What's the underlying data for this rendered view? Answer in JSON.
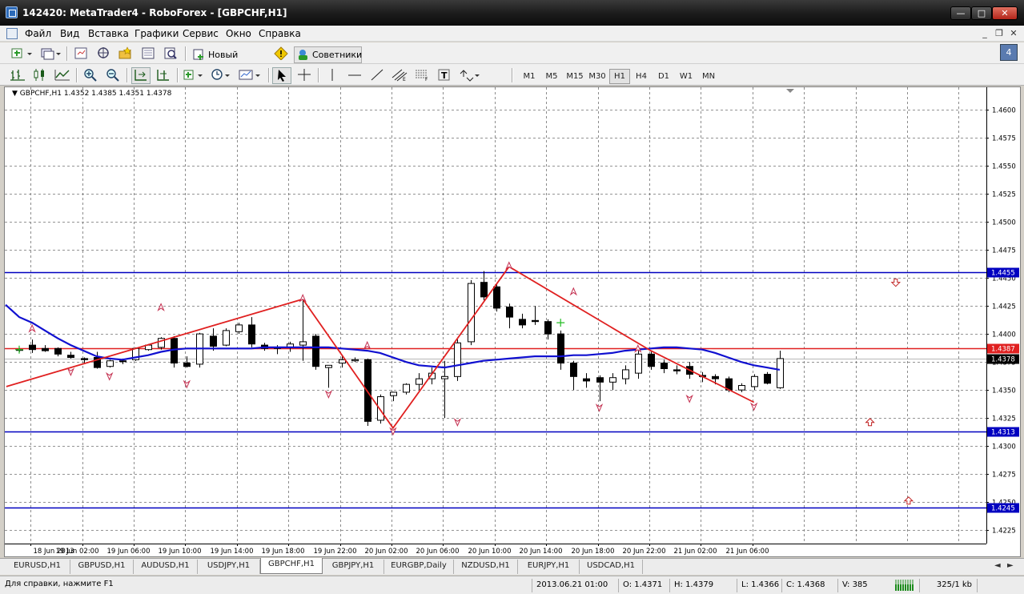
{
  "window": {
    "title": "142420: MetaTrader4 - RoboForex - [GBPCHF,H1]"
  },
  "menu": [
    "Файл",
    "Вид",
    "Вставка",
    "Графики",
    "Сервис",
    "Окно",
    "Справка"
  ],
  "toolbar": {
    "new_order": "Новый Ордер",
    "experts": "Советники"
  },
  "timeframes": [
    "M1",
    "M5",
    "M15",
    "M30",
    "H1",
    "H4",
    "D1",
    "W1",
    "MN"
  ],
  "active_timeframe": "H1",
  "chart_data": {
    "type": "candlestick",
    "header": "GBPCHF,H1  1.4352 1.4385 1.4351 1.4378",
    "symbol": "GBPCHF",
    "period": "H1",
    "ylim": [
      1.4213,
      1.462
    ],
    "y_ticks": [
      "1.4600",
      "1.4575",
      "1.4550",
      "1.4525",
      "1.4500",
      "1.4475",
      "1.4450",
      "1.4425",
      "1.4400",
      "1.4375",
      "1.4350",
      "1.4325",
      "1.4300",
      "1.4275",
      "1.4250",
      "1.4225"
    ],
    "x_tick_labels": [
      "18 Jun 2013",
      "19 Jun 02:00",
      "19 Jun 06:00",
      "19 Jun 10:00",
      "19 Jun 14:00",
      "19 Jun 18:00",
      "19 Jun 22:00",
      "20 Jun 02:00",
      "20 Jun 06:00",
      "20 Jun 10:00",
      "20 Jun 14:00",
      "20 Jun 18:00",
      "20 Jun 22:00",
      "21 Jun 02:00",
      "21 Jun 06:00"
    ],
    "candles": [
      [
        1.4386,
        1.4387,
        1.4384,
        1.4386
      ],
      [
        1.439,
        1.4395,
        1.4383,
        1.4386
      ],
      [
        1.4387,
        1.439,
        1.4384,
        1.4385
      ],
      [
        1.4387,
        1.4388,
        1.438,
        1.4382
      ],
      [
        1.4381,
        1.4384,
        1.4378,
        1.4379
      ],
      [
        1.4378,
        1.4379,
        1.4374,
        1.4377
      ],
      [
        1.4379,
        1.4384,
        1.4369,
        1.437
      ],
      [
        1.4371,
        1.4377,
        1.437,
        1.4376
      ],
      [
        1.4376,
        1.4378,
        1.4373,
        1.4376
      ],
      [
        1.4377,
        1.4388,
        1.4376,
        1.4387
      ],
      [
        1.4386,
        1.4391,
        1.4385,
        1.439
      ],
      [
        1.4388,
        1.4397,
        1.4386,
        1.4396
      ],
      [
        1.4396,
        1.4398,
        1.437,
        1.4374
      ],
      [
        1.4374,
        1.438,
        1.437,
        1.4371
      ],
      [
        1.4373,
        1.4401,
        1.437,
        1.44
      ],
      [
        1.4398,
        1.4405,
        1.4385,
        1.4389
      ],
      [
        1.439,
        1.4405,
        1.4389,
        1.4403
      ],
      [
        1.4402,
        1.441,
        1.44,
        1.4408
      ],
      [
        1.4408,
        1.4415,
        1.4388,
        1.4391
      ],
      [
        1.439,
        1.4392,
        1.4385,
        1.4387
      ],
      [
        1.4388,
        1.439,
        1.4382,
        1.4387
      ],
      [
        1.4388,
        1.4393,
        1.4384,
        1.4391
      ],
      [
        1.439,
        1.443,
        1.4376,
        1.4393
      ],
      [
        1.4398,
        1.44,
        1.4368,
        1.4371
      ],
      [
        1.437,
        1.4372,
        1.4352,
        1.4372
      ],
      [
        1.4374,
        1.438,
        1.437,
        1.4377
      ],
      [
        1.4376,
        1.4379,
        1.4375,
        1.4377
      ],
      [
        1.4377,
        1.4378,
        1.4318,
        1.4322
      ],
      [
        1.4323,
        1.4346,
        1.432,
        1.4344
      ],
      [
        1.4345,
        1.4348,
        1.434,
        1.4348
      ],
      [
        1.4348,
        1.4356,
        1.4346,
        1.4355
      ],
      [
        1.4355,
        1.4365,
        1.435,
        1.436
      ],
      [
        1.436,
        1.437,
        1.4355,
        1.4365
      ],
      [
        1.436,
        1.4376,
        1.4325,
        1.4362
      ],
      [
        1.4362,
        1.4395,
        1.4358,
        1.4392
      ],
      [
        1.4393,
        1.4448,
        1.439,
        1.4445
      ],
      [
        1.4446,
        1.4456,
        1.443,
        1.4433
      ],
      [
        1.4442,
        1.4445,
        1.442,
        1.4423
      ],
      [
        1.4424,
        1.4427,
        1.4405,
        1.4415
      ],
      [
        1.4413,
        1.4418,
        1.4405,
        1.4408
      ],
      [
        1.4412,
        1.4425,
        1.4408,
        1.4411
      ],
      [
        1.4411,
        1.4413,
        1.4395,
        1.44
      ],
      [
        1.44,
        1.4403,
        1.4368,
        1.4374
      ],
      [
        1.4374,
        1.4376,
        1.435,
        1.4362
      ],
      [
        1.436,
        1.4365,
        1.4352,
        1.4358
      ],
      [
        1.4361,
        1.4363,
        1.434,
        1.4357
      ],
      [
        1.4357,
        1.4365,
        1.435,
        1.4361
      ],
      [
        1.436,
        1.4372,
        1.4355,
        1.4368
      ],
      [
        1.4365,
        1.4385,
        1.436,
        1.4382
      ],
      [
        1.4382,
        1.4384,
        1.4368,
        1.4371
      ],
      [
        1.4374,
        1.4377,
        1.4365,
        1.4369
      ],
      [
        1.4368,
        1.4372,
        1.4364,
        1.4367
      ],
      [
        1.4371,
        1.4375,
        1.436,
        1.4364
      ],
      [
        1.4363,
        1.4366,
        1.4357,
        1.4362
      ],
      [
        1.4362,
        1.4364,
        1.4355,
        1.436
      ],
      [
        1.436,
        1.4362,
        1.4348,
        1.435
      ],
      [
        1.435,
        1.4356,
        1.4348,
        1.4354
      ],
      [
        1.4353,
        1.4364,
        1.435,
        1.4362
      ],
      [
        1.4364,
        1.4366,
        1.4355,
        1.4356
      ],
      [
        1.4352,
        1.4385,
        1.4351,
        1.4378
      ]
    ],
    "ma_series": [
      1.4415,
      1.441,
      1.4403,
      1.4396,
      1.439,
      1.4385,
      1.438,
      1.4378,
      1.4377,
      1.4379,
      1.4381,
      1.4384,
      1.4386,
      1.4387,
      1.4387,
      1.4387,
      1.4387,
      1.4387,
      1.4387,
      1.4388,
      1.4388,
      1.4388,
      1.4388,
      1.4388,
      1.4388,
      1.4387,
      1.4386,
      1.4385,
      1.4383,
      1.4379,
      1.4375,
      1.4372,
      1.4371,
      1.437,
      1.4372,
      1.4374,
      1.4376,
      1.4377,
      1.4378,
      1.4379,
      1.438,
      1.438,
      1.438,
      1.4381,
      1.4381,
      1.4382,
      1.4383,
      1.4385,
      1.4386,
      1.4387,
      1.4388,
      1.4388,
      1.4387,
      1.4386,
      1.4383,
      1.4379,
      1.4375,
      1.4372,
      1.437,
      1.4368
    ],
    "zigzag": [
      [
        -1,
        1.4353
      ],
      [
        22,
        1.4431
      ],
      [
        29,
        1.4316
      ],
      [
        38,
        1.446
      ],
      [
        49,
        1.4385
      ],
      [
        57,
        1.4339
      ]
    ],
    "zigzag_triangles": {
      "up": [
        [
          1,
          1.4405
        ],
        [
          11,
          1.4424
        ],
        [
          22,
          1.4432
        ],
        [
          27,
          1.439
        ],
        [
          38,
          1.4461
        ],
        [
          43,
          1.4438
        ],
        [
          48,
          1.4387
        ]
      ],
      "down": [
        [
          4,
          1.4366
        ],
        [
          7,
          1.4362
        ],
        [
          13,
          1.4355
        ],
        [
          24,
          1.4346
        ],
        [
          29,
          1.4313
        ],
        [
          34,
          1.4321
        ],
        [
          45,
          1.4334
        ],
        [
          52,
          1.4342
        ],
        [
          57,
          1.4335
        ]
      ]
    },
    "arrows_up": [
      [
        66,
        1.4321
      ],
      [
        69,
        1.4251
      ]
    ],
    "arrows_down": [
      [
        68,
        1.4446
      ]
    ],
    "hlines": [
      {
        "price": 1.4455,
        "label": "1.4455",
        "color": "#0000c0"
      },
      {
        "price": 1.4387,
        "label": "1.4387",
        "color": "#e02020"
      },
      {
        "price": 1.4313,
        "label": "1.4313",
        "color": "#0000c0"
      },
      {
        "price": 1.4245,
        "label": "1.4245",
        "color": "#0000c0"
      }
    ],
    "last_price": "1.4378",
    "colors": {
      "ma": "#1010d0",
      "zigzag": "#e02020",
      "grid": "#707070",
      "marker": "#c43050"
    }
  },
  "tabs": [
    "EURUSD,H1",
    "GBPUSD,H1",
    "AUDUSD,H1",
    "USDJPY,H1",
    "GBPCHF,H1",
    "GBPJPY,H1",
    "EURGBP,Daily",
    "NZDUSD,H1",
    "EURJPY,H1",
    "USDCAD,H1"
  ],
  "active_tab": "GBPCHF,H1",
  "status": {
    "help": "Для справки, нажмите F1",
    "datetime": "2013.06.21 01:00",
    "open": "O: 1.4371",
    "high": "H: 1.4379",
    "low": "L: 1.4366",
    "close": "C: 1.4368",
    "volume": "V: 385",
    "traffic": "325/1 kb"
  }
}
